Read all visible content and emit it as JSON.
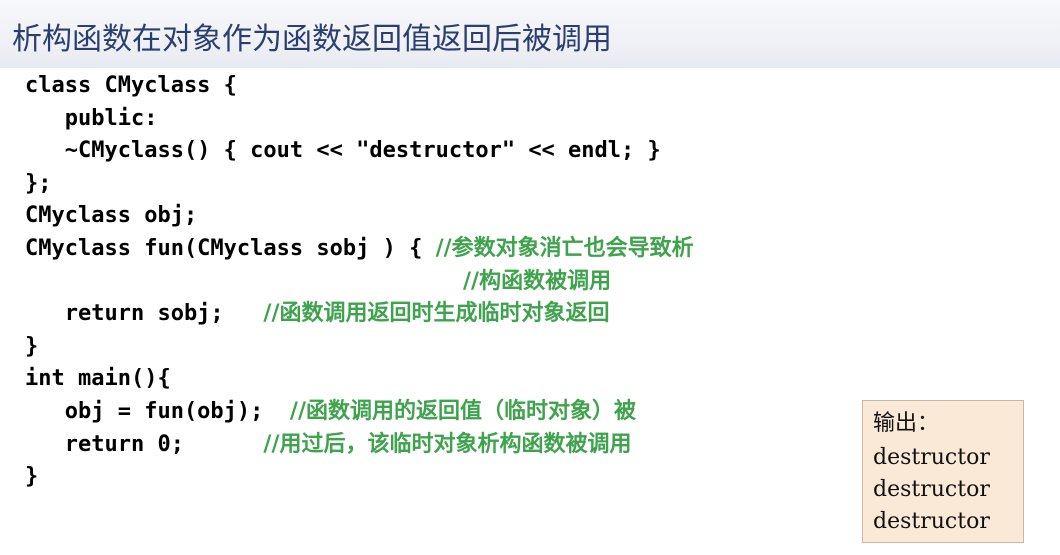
{
  "title": "析构函数在对象作为函数返回值返回后被调用",
  "code": {
    "l1": "class CMyclass {",
    "l2": "   public:",
    "l3": "   ~CMyclass() { cout << \"destructor\" << endl; }",
    "l4": "};",
    "l5": "CMyclass obj;",
    "l6_code": "CMyclass fun(CMyclass sobj ) { ",
    "l6_comment": "//参数对象消亡也会导致析",
    "l7_comment": "//构函数被调用",
    "l8_code": "   return sobj;   ",
    "l8_comment": "//函数调用返回时生成临时对象返回",
    "l9": "}",
    "l10": "int main(){",
    "l11_code": "   obj = fun(obj);  ",
    "l11_comment": "//函数调用的返回值（临时对象）被",
    "l12_code": "   return 0;      ",
    "l12_comment": "//用过后，该临时对象析构函数被调用",
    "l13": "}"
  },
  "output": {
    "label": "输出：",
    "lines": [
      "destructor",
      "destructor",
      "destructor"
    ]
  }
}
